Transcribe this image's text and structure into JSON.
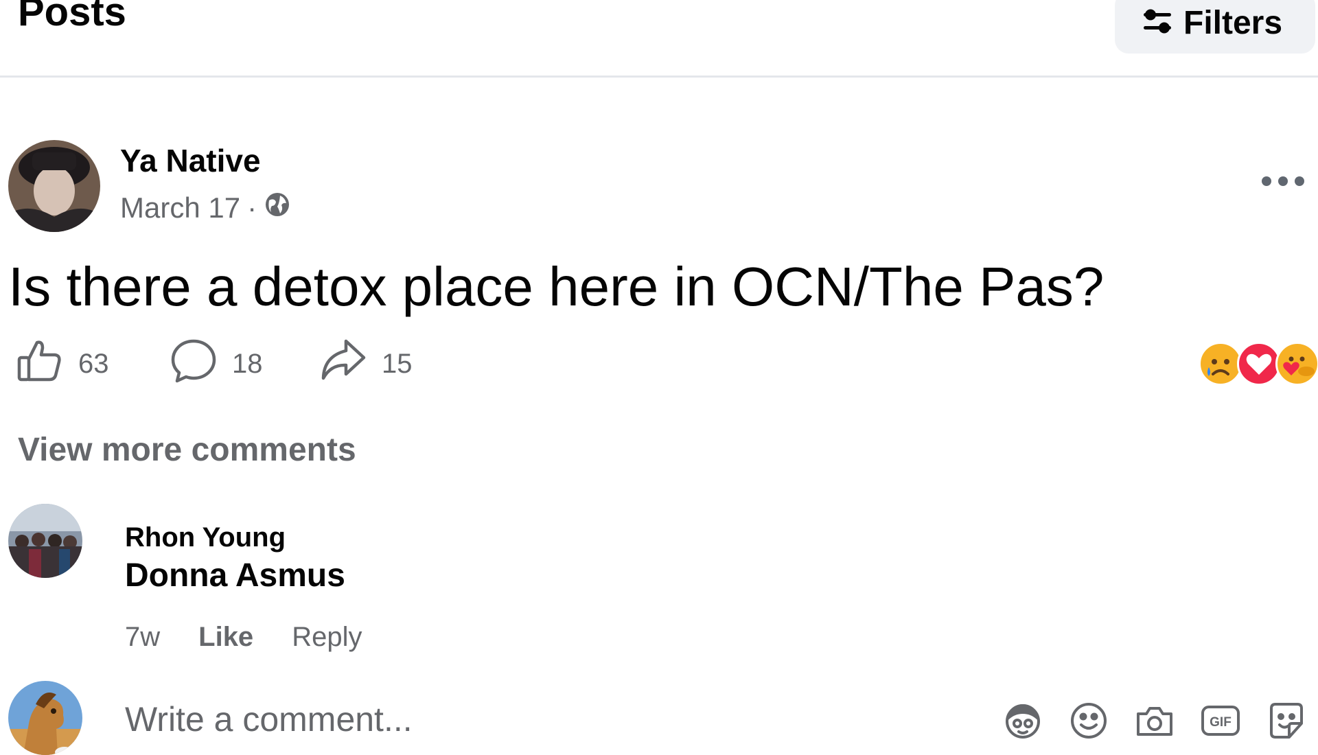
{
  "header": {
    "title": "Posts",
    "filters_label": "Filters",
    "filters_icon": "sliders-icon"
  },
  "post": {
    "author": "Ya Native",
    "date": "March 17",
    "separator": "·",
    "audience_icon": "globe-icon",
    "text": "Is there a detox place here in OCN/The Pas?",
    "likes": "63",
    "comments": "18",
    "shares": "15",
    "reactions": [
      "sad-emoji",
      "love-emoji",
      "care-emoji"
    ],
    "menu_icon": "more-options-icon"
  },
  "comments": {
    "view_more": "View more comments",
    "items": [
      {
        "author": "Rhon Young",
        "text": "Donna Asmus",
        "time": "7w",
        "like_label": "Like",
        "reply_label": "Reply"
      }
    ]
  },
  "composer": {
    "placeholder": "Write a comment...",
    "tools": [
      "avatar-sticker-icon",
      "emoji-icon",
      "camera-icon",
      "gif-icon",
      "sticker-icon"
    ]
  },
  "colors": {
    "text": "#050505",
    "secondary_text": "#65676b",
    "divider": "#e4e6eb",
    "button_bg": "#f0f2f5",
    "love": "#f0284a",
    "sad": "#f7b125"
  }
}
